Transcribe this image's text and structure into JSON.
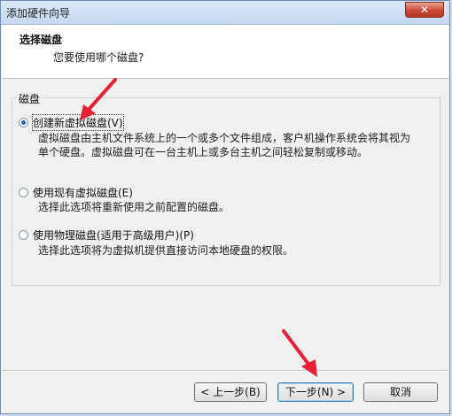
{
  "window": {
    "title": "添加硬件向导",
    "close_label": "✕"
  },
  "header": {
    "title": "选择磁盘",
    "subtitle": "您要使用哪个磁盘?"
  },
  "group": {
    "label": "磁盘"
  },
  "options": [
    {
      "label": "创建新虚拟磁盘(V)",
      "checked": true,
      "description": "虚拟磁盘由主机文件系统上的一个或多个文件组成，客户机操作系统会将其视为单个硬盘。虚拟磁盘可在一台主机上或多台主机之间轻松复制或移动。"
    },
    {
      "label": "使用现有虚拟磁盘(E)",
      "checked": false,
      "description": "选择此选项将重新使用之前配置的磁盘。"
    },
    {
      "label": "使用物理磁盘(适用于高级用户)(P)",
      "checked": false,
      "description": "选择此选项将为虚拟机提供直接访问本地硬盘的权限。"
    }
  ],
  "buttons": {
    "back": "< 上一步(B)",
    "next": "下一步(N) >",
    "cancel": "取消"
  },
  "colors": {
    "annotation_arrow": "#e8203a"
  }
}
